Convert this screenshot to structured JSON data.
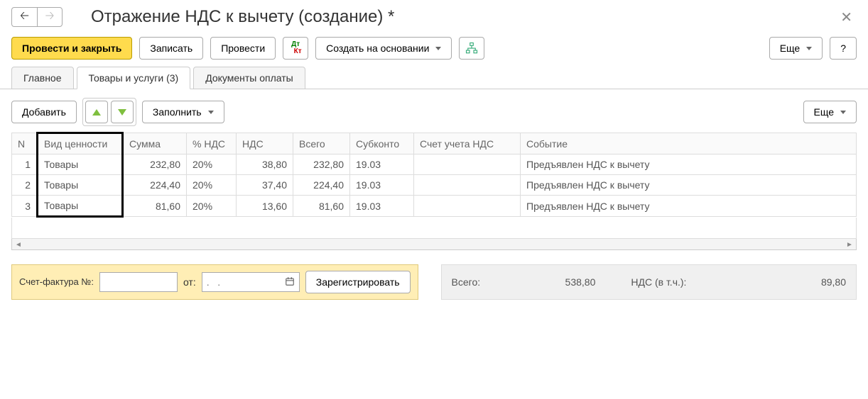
{
  "title": "Отражение НДС к вычету (создание) *",
  "toolbar": {
    "post_close": "Провести и закрыть",
    "save": "Записать",
    "post": "Провести",
    "create_based": "Создать на основании",
    "more": "Еще",
    "help": "?"
  },
  "tabs": {
    "main": "Главное",
    "goods": "Товары и услуги (3)",
    "payments": "Документы оплаты"
  },
  "sub_toolbar": {
    "add": "Добавить",
    "fill": "Заполнить",
    "more": "Еще"
  },
  "columns": {
    "n": "N",
    "kind": "Вид ценности",
    "sum": "Сумма",
    "vat_pct": "% НДС",
    "vat": "НДС",
    "total": "Всего",
    "subconto": "Субконто",
    "vat_account": "Счет учета НДС",
    "event": "Событие"
  },
  "rows": [
    {
      "n": "1",
      "kind": "Товары",
      "sum": "232,80",
      "vat_pct": "20%",
      "vat": "38,80",
      "total": "232,80",
      "subconto": "19.03",
      "vat_account": "",
      "event": "Предъявлен НДС к вычету"
    },
    {
      "n": "2",
      "kind": "Товары",
      "sum": "224,40",
      "vat_pct": "20%",
      "vat": "37,40",
      "total": "224,40",
      "subconto": "19.03",
      "vat_account": "",
      "event": "Предъявлен НДС к вычету"
    },
    {
      "n": "3",
      "kind": "Товары",
      "sum": "81,60",
      "vat_pct": "20%",
      "vat": "13,60",
      "total": "81,60",
      "subconto": "19.03",
      "vat_account": "",
      "event": "Предъявлен НДС к вычету"
    }
  ],
  "invoice": {
    "label": "Счет-фактура №:",
    "from": "от:",
    "date_placeholder": ".   .",
    "register": "Зарегистрировать"
  },
  "totals": {
    "total_label": "Всего:",
    "total_value": "538,80",
    "vat_label": "НДС (в т.ч.):",
    "vat_value": "89,80"
  }
}
